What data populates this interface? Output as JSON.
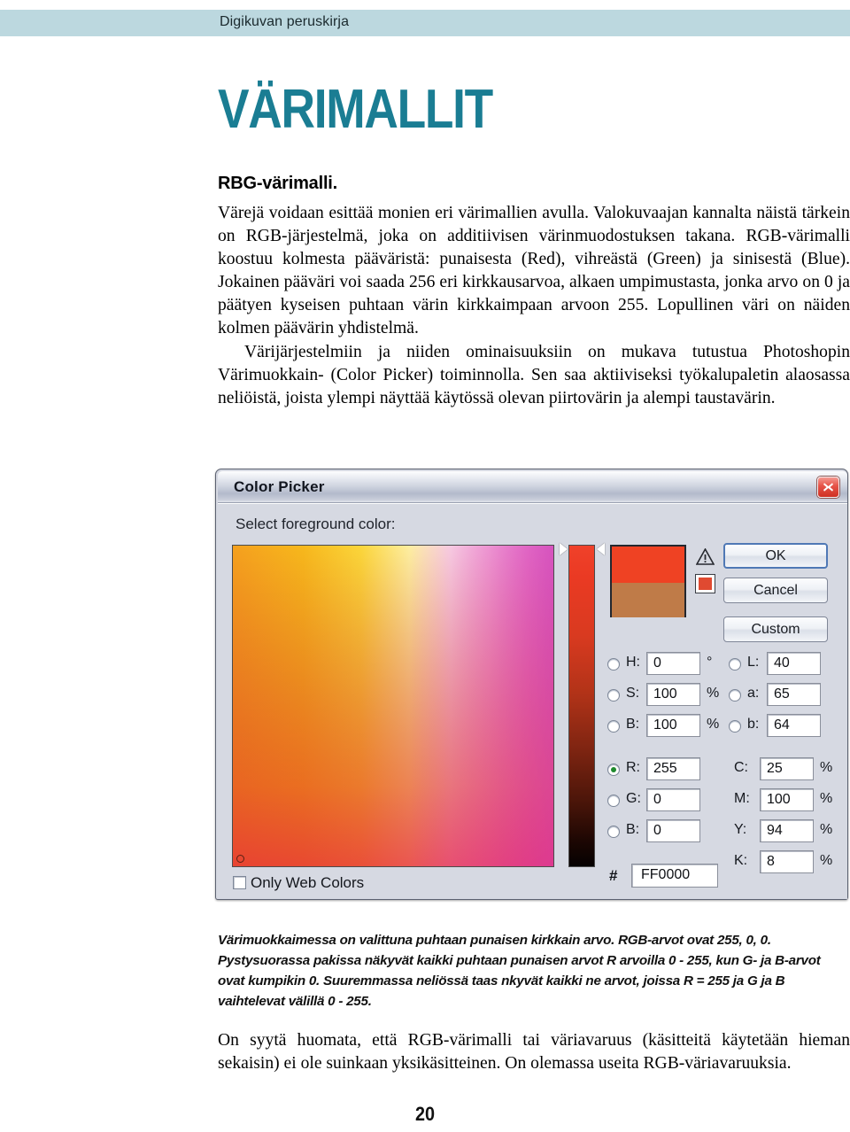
{
  "header": {
    "running_title": "Digikuvan peruskirja"
  },
  "page": {
    "number": "20"
  },
  "chapter": {
    "title": "VÄRIMALLIT"
  },
  "section": {
    "lede": "RBG-värimalli.",
    "paragraph1": "Värejä voidaan esittää monien eri värimallien avulla. Valokuvaajan kannalta näistä tärkein on RGB-järjestelmä, joka on additiivisen värinmuodostuksen takana. RGB-värimalli koostuu kolmesta pääväristä: punaisesta (Red), vihreästä (Green) ja sinisestä (Blue). Jokainen pääväri voi saada 256 eri kirkkausarvoa, alkaen umpimustasta, jonka arvo on 0 ja päätyen kyseisen puhtaan värin kirkkaimpaan arvoon 255. Lopullinen väri on näiden kolmen päävärin yhdistelmä.",
    "paragraph2": "Värijärjestelmiin ja niiden ominaisuuksiin on mukava tutustua Photoshopin Värimuokkain- (Color Picker) toiminnolla. Sen saa aktiiviseksi työkalupaletin alaosassa neliöistä, joista ylempi näyttää käytössä olevan piirtovärin ja alempi taustavärin."
  },
  "caption": {
    "text": "Värimuokkaimessa on valittuna puhtaan punaisen kirkkain arvo. RGB-arvot ovat 255, 0, 0. Pystysuorassa pakissa näkyvät kaikki puhtaan punaisen arvot R arvoilla 0 - 255, kun G- ja B-arvot ovat kumpikin 0. Suuremmassa neliössä taas nkyvät kaikki ne arvot, joissa R = 255 ja G ja B vaihtelevat välillä 0 - 255."
  },
  "closing": {
    "text": "On syytä huomata, että RGB-värimalli tai väriavaruus (käsitteitä käytetään hieman sekaisin) ei ole suinkaan yksikäsitteinen. On olemassa useita RGB-väriavaruuksia."
  },
  "dialog": {
    "title": "Color Picker",
    "subtitle": "Select foreground color:",
    "close_label": "×",
    "buttons": {
      "ok": "OK",
      "cancel": "Cancel",
      "custom": "Custom"
    },
    "preview": {
      "new_color": "#ef4223",
      "previous_color": "#bf7b48"
    },
    "hsb": [
      {
        "label": "H:",
        "value": "0",
        "unit": "°",
        "selected": false
      },
      {
        "label": "S:",
        "value": "100",
        "unit": "%",
        "selected": false
      },
      {
        "label": "B:",
        "value": "100",
        "unit": "%",
        "selected": false
      }
    ],
    "lab": [
      {
        "label": "L:",
        "value": "40",
        "unit": "",
        "selected": false
      },
      {
        "label": "a:",
        "value": "65",
        "unit": "",
        "selected": false
      },
      {
        "label": "b:",
        "value": "64",
        "unit": "",
        "selected": false
      }
    ],
    "rgb": [
      {
        "label": "R:",
        "value": "255",
        "unit": "",
        "selected": true
      },
      {
        "label": "G:",
        "value": "0",
        "unit": "",
        "selected": false
      },
      {
        "label": "B:",
        "value": "0",
        "unit": "",
        "selected": false
      }
    ],
    "cmyk": [
      {
        "label": "C:",
        "value": "25",
        "unit": "%"
      },
      {
        "label": "M:",
        "value": "100",
        "unit": "%"
      },
      {
        "label": "Y:",
        "value": "94",
        "unit": "%"
      },
      {
        "label": "K:",
        "value": "8",
        "unit": "%"
      }
    ],
    "hex": {
      "prefix": "#",
      "value": "FF0000"
    },
    "only_web_colors": {
      "label": "Only Web Colors",
      "checked": false
    }
  },
  "colors": {
    "header_band": "#bcd8df",
    "chapter_title": "#1a7d93",
    "dialog_face": "#d6d9e2",
    "close_button": "#cf2f22"
  }
}
